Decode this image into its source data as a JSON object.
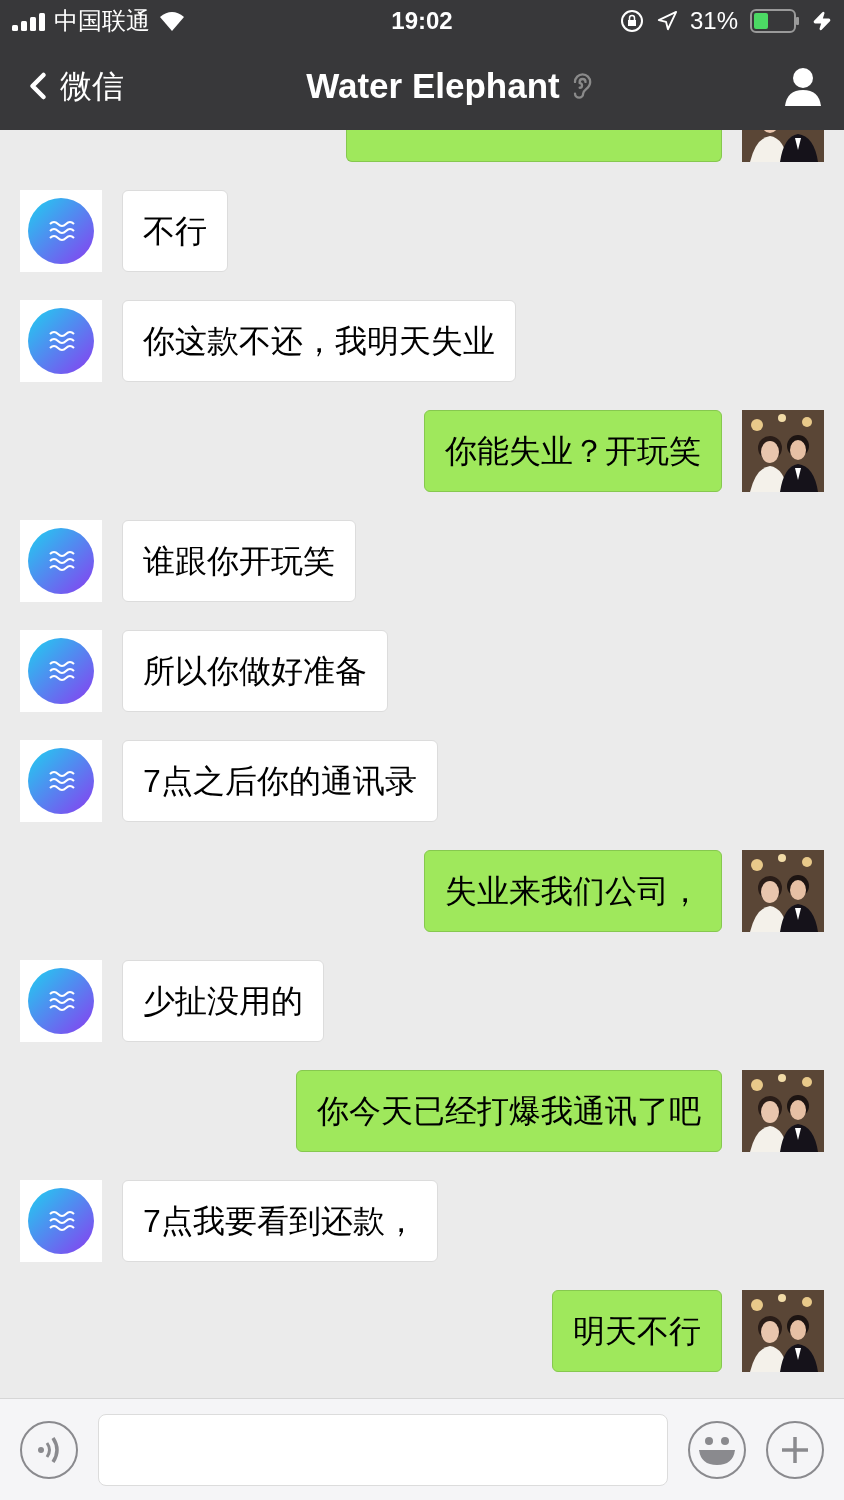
{
  "status_bar": {
    "carrier": "中国联通",
    "time": "19:02",
    "battery": "31%"
  },
  "nav": {
    "back_label": "微信",
    "title": "Water Elephant"
  },
  "clipped_message": {
    "kind": "outgoing"
  },
  "messages": [
    {
      "kind": "incoming",
      "text": "不行"
    },
    {
      "kind": "incoming",
      "text": "你这款不还，我明天失业"
    },
    {
      "kind": "outgoing",
      "text": "你能失业？开玩笑"
    },
    {
      "kind": "incoming",
      "text": "谁跟你开玩笑"
    },
    {
      "kind": "incoming",
      "text": "所以你做好准备"
    },
    {
      "kind": "incoming",
      "text": "7点之后你的通讯录"
    },
    {
      "kind": "outgoing",
      "text": "失业来我们公司，"
    },
    {
      "kind": "incoming",
      "text": "少扯没用的"
    },
    {
      "kind": "outgoing",
      "text": "你今天已经打爆我通讯了吧"
    },
    {
      "kind": "incoming",
      "text": "7点我要看到还款，"
    },
    {
      "kind": "outgoing",
      "text": "明天不行"
    }
  ]
}
